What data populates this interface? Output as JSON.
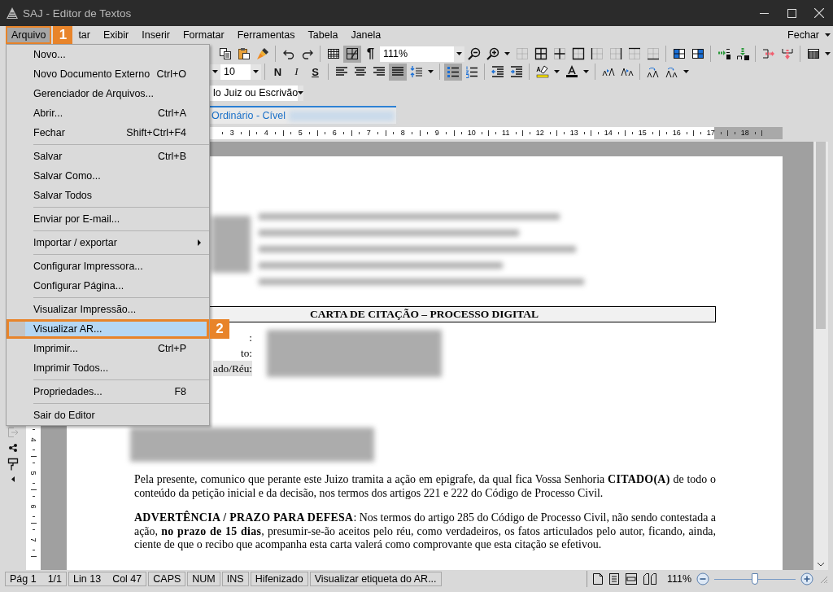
{
  "window": {
    "title": "SAJ - Editor de Textos"
  },
  "menubar": {
    "items": [
      {
        "label": "Arquivo",
        "selected": true
      },
      {
        "label": "tar",
        "selected": false
      },
      {
        "label": "Exibir",
        "selected": false
      },
      {
        "label": "Inserir",
        "selected": false
      },
      {
        "label": "Formatar",
        "selected": false
      },
      {
        "label": "Ferramentas",
        "selected": false
      },
      {
        "label": "Tabela",
        "selected": false
      },
      {
        "label": "Janela",
        "selected": false
      }
    ],
    "close_label": "Fechar"
  },
  "toolbar_rows": [
    {
      "items": [
        {
          "kind": "copy",
          "pressed": false
        },
        {
          "kind": "paste",
          "pressed": false
        },
        {
          "kind": "brush",
          "pressed": false
        },
        {
          "kind": "sep"
        },
        {
          "kind": "undo",
          "pressed": false
        },
        {
          "kind": "redo",
          "pressed": false
        },
        {
          "kind": "sep"
        },
        {
          "kind": "table",
          "pressed": false
        },
        {
          "kind": "layout",
          "pressed": true
        },
        {
          "kind": "pilcrow",
          "label": "¶",
          "pressed": false
        },
        {
          "kind": "combo",
          "value": "111%"
        },
        {
          "kind": "zoom-out",
          "pressed": false
        },
        {
          "kind": "zoom-in",
          "pressed": false
        },
        {
          "kind": "caret"
        },
        {
          "kind": "border-none",
          "pressed": false
        },
        {
          "kind": "border-all",
          "pressed": false
        },
        {
          "kind": "border-inner",
          "pressed": false
        },
        {
          "kind": "border-outer",
          "pressed": false
        },
        {
          "kind": "border-left",
          "pressed": false
        },
        {
          "kind": "border-right",
          "pressed": false
        },
        {
          "kind": "border-top",
          "pressed": false
        },
        {
          "kind": "border-bottom",
          "pressed": false
        },
        {
          "kind": "sep"
        },
        {
          "kind": "cell-left",
          "pressed": false
        },
        {
          "kind": "cell-right",
          "pressed": false
        },
        {
          "kind": "sep"
        },
        {
          "kind": "insert-col",
          "pressed": false
        },
        {
          "kind": "insert-row",
          "pressed": false
        },
        {
          "kind": "sep"
        },
        {
          "kind": "delete-col",
          "pressed": false
        },
        {
          "kind": "delete-row",
          "pressed": false
        },
        {
          "kind": "sep"
        },
        {
          "kind": "shade",
          "pressed": false
        },
        {
          "kind": "caret"
        }
      ]
    },
    {
      "items": [
        {
          "kind": "combo-end"
        },
        {
          "kind": "combo",
          "value": "10"
        },
        {
          "kind": "sep"
        },
        {
          "kind": "bold",
          "label": "N",
          "pressed": false
        },
        {
          "kind": "italic",
          "label": "I",
          "pressed": false
        },
        {
          "kind": "strike",
          "label": "S",
          "pressed": false
        },
        {
          "kind": "sep"
        },
        {
          "kind": "align-left",
          "pressed": false
        },
        {
          "kind": "align-center",
          "pressed": false
        },
        {
          "kind": "align-right",
          "pressed": false
        },
        {
          "kind": "align-justify",
          "pressed": true
        },
        {
          "kind": "spacing",
          "pressed": false
        },
        {
          "kind": "caret"
        },
        {
          "kind": "sep"
        },
        {
          "kind": "list-bullet",
          "pressed": true
        },
        {
          "kind": "list-number",
          "pressed": false
        },
        {
          "kind": "sep"
        },
        {
          "kind": "outdent",
          "pressed": false
        },
        {
          "kind": "indent",
          "pressed": false
        },
        {
          "kind": "sep"
        },
        {
          "kind": "highlight",
          "pressed": false
        },
        {
          "kind": "caret"
        },
        {
          "kind": "font-color",
          "pressed": false
        },
        {
          "kind": "caret"
        },
        {
          "kind": "sep"
        },
        {
          "kind": "grow",
          "pressed": false
        },
        {
          "kind": "shrink",
          "pressed": false
        },
        {
          "kind": "sep"
        },
        {
          "kind": "case-lower",
          "pressed": false
        },
        {
          "kind": "case-upper",
          "pressed": false
        },
        {
          "kind": "caret"
        }
      ]
    },
    {
      "items": [
        {
          "kind": "combo",
          "value": "lo Juiz ou Escrivão"
        }
      ]
    }
  ],
  "document_tab": {
    "label": "Ordinário - Cível"
  },
  "ruler": {
    "numbers": [
      "3",
      "4",
      "5",
      "6",
      "7",
      "8",
      "9",
      "10",
      "11",
      "12",
      "13",
      "14",
      "15",
      "16",
      "17",
      "18"
    ]
  },
  "vertical_ruler": {
    "numbers": [
      "4",
      "5",
      "6",
      "7"
    ]
  },
  "document": {
    "heading": "CARTA DE CITAÇÃO – PROCESSO DIGITAL",
    "fields": [
      {
        "label": ":",
        "highlighted": false
      },
      {
        "label": "to:",
        "highlighted": false
      },
      {
        "label": "ado/Réu:",
        "highlighted": true
      }
    ],
    "paragraphs": [
      "Pela presente, comunico que perante este Juizo tramita a ação em epigrafe, da qual fica Vossa Senhoria **CITADO(A)** de todo o conteúdo da petição inicial e da decisão, nos termos dos artigos 221 e 222 do Código de Processo Civil.",
      "**ADVERTÊNCIA / PRAZO PARA DEFESA**: Nos termos do artigo 285 do Código de Processo Civil, não sendo contestada a ação, **no prazo de 15 dias**, presumir-se-ão aceitos pelo réu, como verdadeiros, os fatos articulados pelo autor, ficando, ainda, ciente de que o recibo que acompanha esta carta valerá como comprovante que esta citação se efetivou."
    ]
  },
  "file_menu": {
    "items": [
      {
        "kind": "item",
        "label": "Novo...",
        "selected": false,
        "has_submenu": false
      },
      {
        "kind": "item",
        "label": "Novo Documento Externo",
        "shortcut": "Ctrl+O",
        "selected": false,
        "has_submenu": false
      },
      {
        "kind": "item",
        "label": "Gerenciador de Arquivos...",
        "selected": false,
        "has_submenu": false
      },
      {
        "kind": "item",
        "label": "Abrir...",
        "shortcut": "Ctrl+A",
        "selected": false,
        "has_submenu": false
      },
      {
        "kind": "item",
        "label": "Fechar",
        "shortcut": "Shift+Ctrl+F4",
        "selected": false,
        "has_submenu": false
      },
      {
        "kind": "separator"
      },
      {
        "kind": "item",
        "label": "Salvar",
        "shortcut": "Ctrl+B",
        "selected": false,
        "has_submenu": false
      },
      {
        "kind": "item",
        "label": "Salvar Como...",
        "selected": false,
        "has_submenu": false
      },
      {
        "kind": "item",
        "label": "Salvar Todos",
        "selected": false,
        "has_submenu": false
      },
      {
        "kind": "separator"
      },
      {
        "kind": "item",
        "label": "Enviar por E-mail...",
        "selected": false,
        "has_submenu": false
      },
      {
        "kind": "separator"
      },
      {
        "kind": "item",
        "label": "Importar / exportar",
        "selected": false,
        "has_submenu": true
      },
      {
        "kind": "separator"
      },
      {
        "kind": "item",
        "label": "Configurar Impressora...",
        "selected": false,
        "has_submenu": false
      },
      {
        "kind": "item",
        "label": "Configurar Página...",
        "selected": false,
        "has_submenu": false
      },
      {
        "kind": "separator"
      },
      {
        "kind": "item",
        "label": "Visualizar Impressão...",
        "selected": false,
        "has_submenu": false
      },
      {
        "kind": "item",
        "label": "Visualizar AR...",
        "selected": true,
        "has_submenu": false
      },
      {
        "kind": "item",
        "label": "Imprimir...",
        "shortcut": "Ctrl+P",
        "selected": false,
        "has_submenu": false
      },
      {
        "kind": "item",
        "label": "Imprimir Todos...",
        "selected": false,
        "has_submenu": false
      },
      {
        "kind": "separator"
      },
      {
        "kind": "item",
        "label": "Propriedades...",
        "shortcut": "F8",
        "selected": false,
        "has_submenu": false
      },
      {
        "kind": "separator"
      },
      {
        "kind": "item",
        "label": "Sair do Editor",
        "selected": false,
        "has_submenu": false
      }
    ]
  },
  "callouts": [
    {
      "label": "1"
    },
    {
      "label": "2"
    }
  ],
  "status_bar": {
    "cells": [
      {
        "texts": [
          "Pág 1",
          "1/1"
        ]
      },
      {
        "texts": [
          "Lin 13",
          "Col 47"
        ]
      },
      {
        "texts": [
          "CAPS"
        ]
      },
      {
        "texts": [
          "NUM"
        ]
      },
      {
        "texts": [
          "INS"
        ]
      },
      {
        "texts": [
          "Hifenizado"
        ]
      },
      {
        "texts": [
          "Visualizar etiqueta do AR..."
        ]
      }
    ],
    "zoom": "111%",
    "zoom_slider": {
      "level": 0.5
    }
  }
}
